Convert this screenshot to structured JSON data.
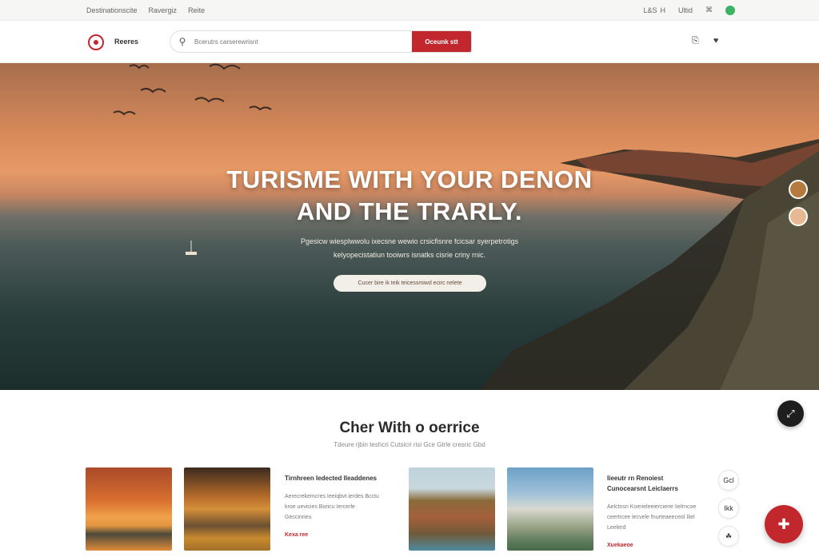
{
  "utility": {
    "links": [
      "Destinationscite",
      "Ravergiz",
      "Reite"
    ],
    "right_lang": "L&S",
    "right_mid": "H",
    "right_user": "Ultid",
    "right_icon": "⌘"
  },
  "header": {
    "brand": "Reeres",
    "search": {
      "placeholder": "Bcerutrs carserewrisnt",
      "button_label": "Oceunk stt"
    },
    "icons": [
      "⎘",
      "♥",
      "☰"
    ]
  },
  "hero": {
    "title_line1": "TURISME WITH YOUR DENON",
    "title_line2": "AND THE TRARLY.",
    "subtitle_line1": "Pgesicw wiesplwwolu ixecsne wewio crsicfisnre fcicsar syerpetrotigs",
    "subtitle_line2": "kelyopecistatiun tooiwrs isnatks cisrie criny rnic.",
    "cta_label": "Cucer bire ik teik teicessmiwd ecirc nelete"
  },
  "section": {
    "title": "Cher With o oerrice",
    "subtitle": "Tdeure rjbin teshcri Cutsicri risi Gce Gtrle cresric Gbd",
    "cards": [
      {
        "title": "Tirnhreen Iedected Ileaddenes",
        "desc": "Aerecrekemcres Ieeiqbvt ierdes Bcctu kroe uevicies Boricu Iercerle Geccinrieu",
        "link": "Kexa ree"
      },
      {
        "title": "Iieeutr rn Renoiest Cunocearsnt Leiclaerrs",
        "desc": "Aelctnsn Koerieleeiercierie Iielrncoe ceertrcee lecvele fnurteaeeceol Iliel Leelerd",
        "link": "Xuekaeoe"
      }
    ]
  },
  "icons": {
    "side_buttons": [
      "Gcl",
      "Ikk",
      "☘"
    ],
    "float_dark": "⤢",
    "float_red": "✚"
  },
  "colors": {
    "accent": "#c2272d",
    "hero_sky_top": "#a66e4c",
    "hero_glow": "#e79a66",
    "sea": "#283c3a"
  }
}
